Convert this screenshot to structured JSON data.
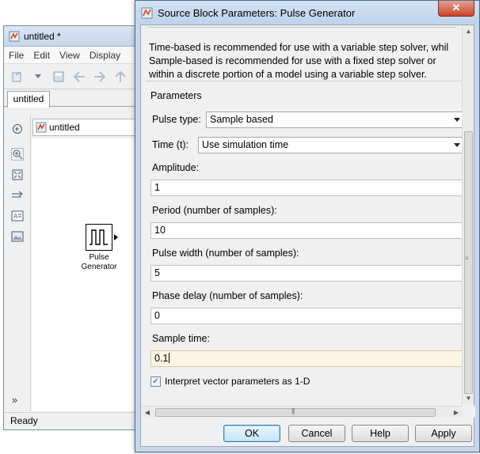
{
  "background_window": {
    "title": "untitled *",
    "menu": [
      "File",
      "Edit",
      "View",
      "Display"
    ],
    "tab": "untitled",
    "address": "untitled",
    "block_label": [
      "Pulse",
      "Generator"
    ],
    "status": "Ready",
    "more_chevron": "»"
  },
  "dialog": {
    "title": "Source Block Parameters: Pulse Generator",
    "close_glyph": "✕",
    "description_lines": [
      "Time-based is recommended for use with a variable step solver, whil",
      "Sample-based is recommended for use with a fixed step solver or",
      "within a discrete portion of a model using a variable step solver."
    ],
    "group_label": "Parameters",
    "pulse_type": {
      "label": "Pulse type:",
      "value": "Sample based"
    },
    "time": {
      "label": "Time (t):",
      "value": "Use simulation time"
    },
    "amplitude": {
      "label": "Amplitude:",
      "value": "1"
    },
    "period": {
      "label": "Period (number of samples):",
      "value": "10"
    },
    "pulse_width": {
      "label": "Pulse width (number of samples):",
      "value": "5"
    },
    "phase_delay": {
      "label": "Phase delay (number of samples):",
      "value": "0"
    },
    "sample_time": {
      "label": "Sample time:",
      "value": "0.1"
    },
    "interpret_vector": {
      "label": "Interpret vector parameters as 1-D",
      "checked": true,
      "check_glyph": "✓"
    },
    "buttons": {
      "ok": "OK",
      "cancel": "Cancel",
      "help": "Help",
      "apply": "Apply"
    }
  },
  "colors": {
    "title_bar": "#c7d7ea",
    "client_bg": "#f0f0f0",
    "active_field": "#fdf5e4",
    "close_button": "#c9452b"
  }
}
